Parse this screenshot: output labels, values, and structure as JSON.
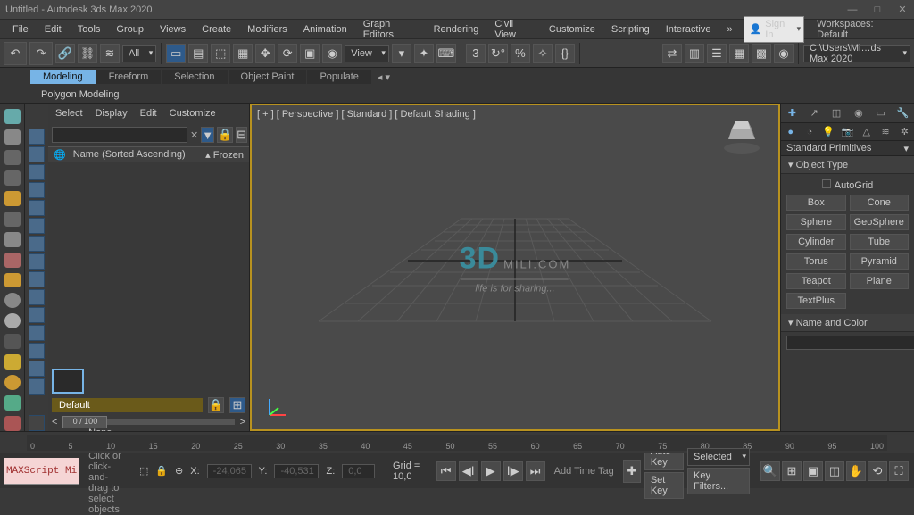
{
  "titlebar": {
    "title": "Untitled - Autodesk 3ds Max 2020"
  },
  "menubar": {
    "items": [
      "File",
      "Edit",
      "Tools",
      "Group",
      "Views",
      "Create",
      "Modifiers",
      "Animation",
      "Graph Editors",
      "Rendering",
      "Civil View",
      "Customize",
      "Scripting",
      "Interactive"
    ],
    "signin": "Sign In",
    "workspaces_label": "Workspaces: Default"
  },
  "toolbar": {
    "filter_all": "All",
    "view_label": "View",
    "path_input": "C:\\Users\\Mi…ds Max 2020"
  },
  "ribbon": {
    "tabs": [
      "Modeling",
      "Freeform",
      "Selection",
      "Object Paint",
      "Populate"
    ],
    "subtab": "Polygon Modeling"
  },
  "scene_explorer": {
    "menu": [
      "Select",
      "Display",
      "Edit",
      "Customize"
    ],
    "col_name": "Name (Sorted Ascending)",
    "col_frozen": "▴ Frozen",
    "layer_name": "Default",
    "slider_value": "0 / 100"
  },
  "viewport": {
    "label": "[ + ] [ Perspective ] [ Standard ] [ Default Shading ]",
    "watermark_big": "3D",
    "watermark_suffix": "MILI.COM",
    "watermark_sub": "life is for sharing..."
  },
  "command_panel": {
    "category": "Standard Primitives",
    "rollout_objtype": "Object Type",
    "autogrid": "AutoGrid",
    "buttons": [
      [
        "Box",
        "Cone"
      ],
      [
        "Sphere",
        "GeoSphere"
      ],
      [
        "Cylinder",
        "Tube"
      ],
      [
        "Torus",
        "Pyramid"
      ],
      [
        "Teapot",
        "Plane"
      ],
      [
        "TextPlus",
        ""
      ]
    ],
    "rollout_name": "Name and Color"
  },
  "timeline": {
    "ticks": [
      "0",
      "5",
      "10",
      "15",
      "20",
      "25",
      "30",
      "35",
      "40",
      "45",
      "50",
      "55",
      "60",
      "65",
      "70",
      "75",
      "80",
      "85",
      "90",
      "95",
      "100"
    ]
  },
  "status": {
    "maxscript": "MAXScript Mi",
    "selection_msg": "None Selected",
    "prompt_msg": "Click or click-and-drag to select objects",
    "x_label": "X:",
    "x_val": "-24,065",
    "y_label": "Y:",
    "y_val": "-40,531",
    "z_label": "Z:",
    "z_val": "0,0",
    "grid_label": "Grid = 10,0",
    "addtag": "Add Time Tag",
    "autokey": "Auto Key",
    "setkey": "Set Key",
    "selected_mode": "Selected",
    "keyfilters": "Key Filters..."
  }
}
